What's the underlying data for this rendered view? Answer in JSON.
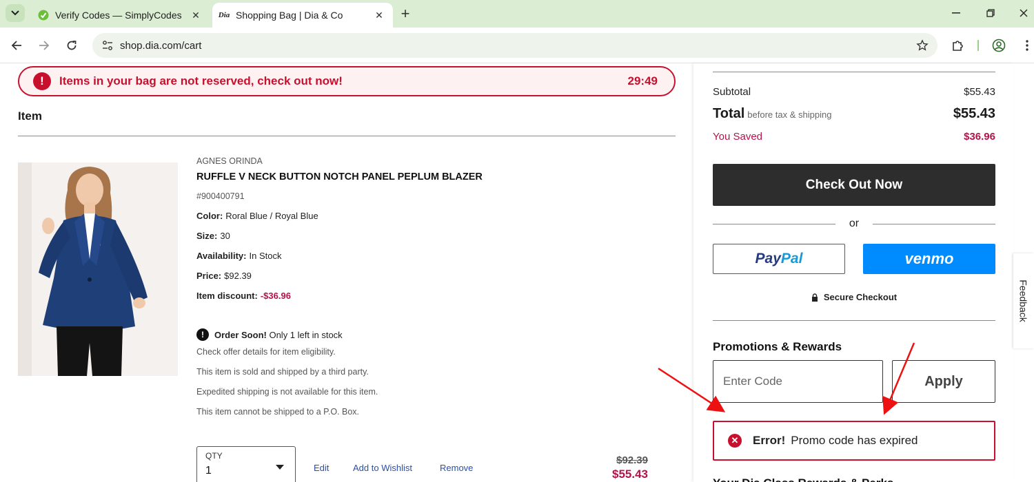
{
  "browser": {
    "tabs": [
      {
        "title": "Verify Codes — SimplyCodes",
        "active": false,
        "favicon": "simplycodes-icon"
      },
      {
        "title": "Shopping Bag | Dia & Co",
        "active": true,
        "favicon": "dia-logo-icon",
        "favicon_text": "Dia"
      }
    ],
    "url": "shop.dia.com/cart"
  },
  "banner": {
    "message": "Items in your bag are not reserved, check out now!",
    "timer": "29:49",
    "icon_text": "!"
  },
  "cart": {
    "item_heading": "Item",
    "item": {
      "brand": "AGNES ORINDA",
      "name": "RUFFLE V NECK BUTTON NOTCH PANEL PEPLUM BLAZER",
      "sku": "#900400791",
      "color_label": "Color:",
      "color_value": "Roral Blue / Royal Blue",
      "size_label": "Size:",
      "size_value": "30",
      "availability_label": "Availability:",
      "availability_value": "In Stock",
      "price_label": "Price:",
      "price_value": "$92.39",
      "discount_label": "Item discount:",
      "discount_value": "-$36.96",
      "order_soon_label": "Order Soon!",
      "order_soon_text": "Only 1 left in stock",
      "notes": [
        "Check offer details for item eligibility.",
        "This item is sold and shipped by a third party.",
        "Expedited shipping is not available for this item.",
        "This item cannot be shipped to a P.O. Box."
      ],
      "qty_label": "QTY",
      "qty_value": "1",
      "links": {
        "edit": "Edit",
        "wishlist": "Add to Wishlist",
        "remove": "Remove"
      },
      "original_price": "$92.39",
      "sale_price": "$55.43"
    }
  },
  "summary": {
    "subtotal_label": "Subtotal",
    "subtotal_value": "$55.43",
    "total_label": "Total",
    "total_sub": "before tax & shipping",
    "total_value": "$55.43",
    "saved_label": "You Saved",
    "saved_value": "$36.96",
    "checkout_label": "Check Out Now",
    "or_text": "or",
    "paypal_part1": "Pay",
    "paypal_part2": "Pal",
    "venmo_label": "venmo",
    "secure_label": "Secure Checkout",
    "promo_title": "Promotions & Rewards",
    "promo_placeholder": "Enter Code",
    "apply_label": "Apply",
    "error_strong": "Error!",
    "error_message": "Promo code has expired",
    "next_heading": "Your Dia Class Rewards & Perks"
  },
  "feedback_label": "Feedback",
  "colors": {
    "alert_red": "#c8102e",
    "price_magenta": "#b3124a",
    "checkout_dark": "#2d2d2d",
    "venmo_blue": "#008cff",
    "link_blue": "#2a4fa8",
    "chrome_green": "#dbeed3"
  }
}
